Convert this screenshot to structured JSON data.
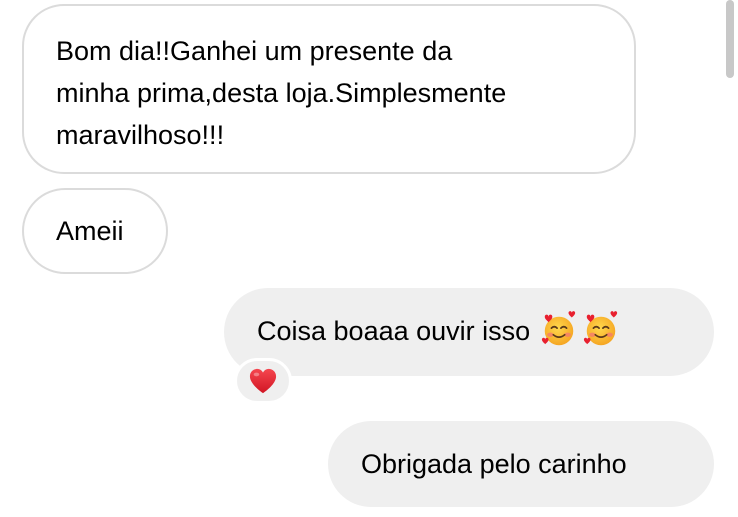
{
  "messages": [
    {
      "direction": "received",
      "lines": [
        "Bom dia!!Ganhei um presente da",
        "minha prima,desta loja.Simplesmente",
        "maravilhoso!!!"
      ]
    },
    {
      "direction": "received",
      "text": "Ameii"
    },
    {
      "direction": "sent",
      "text": "Coisa boaaa ouvir isso",
      "emojis": [
        "smiling-face-with-hearts-emoji",
        "smiling-face-with-hearts-emoji"
      ],
      "reaction": "red-heart-icon"
    },
    {
      "direction": "sent",
      "text": "Obrigada pelo carinho"
    }
  ],
  "colors": {
    "sent_bubble": "#efefef",
    "received_border": "#dbdbdb",
    "heart": "#e8202f"
  }
}
